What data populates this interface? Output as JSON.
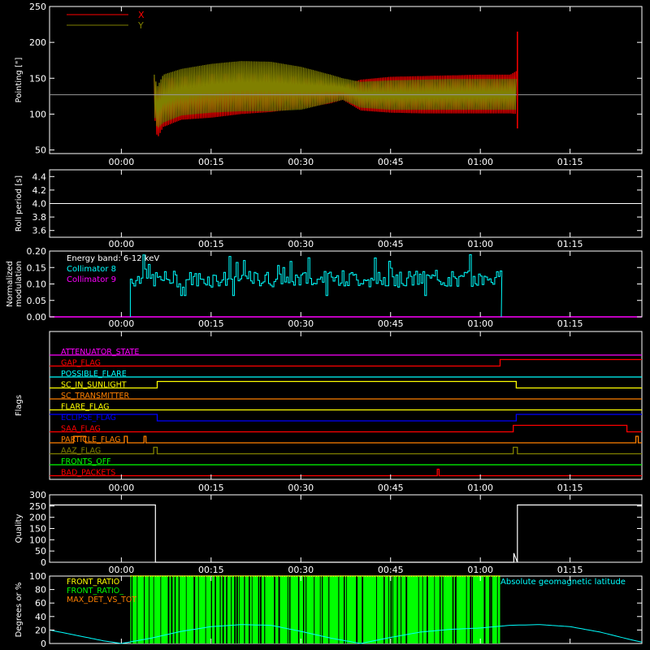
{
  "chart_data": [
    {
      "panel": "pointing",
      "type": "line",
      "ylabel": "Pointing [\"]",
      "ylim": [
        45,
        250
      ],
      "yticks": [
        50,
        100,
        150,
        200,
        250
      ],
      "xlim_minutes": [
        -12,
        87
      ],
      "xticks": [
        "00:00",
        "00:15",
        "00:30",
        "00:45",
        "01:00",
        "01:15"
      ],
      "xtick_minutes": [
        0,
        15,
        30,
        45,
        60,
        75
      ],
      "legend": [
        {
          "name": "X",
          "color": "#ff0000"
        },
        {
          "name": "Y",
          "color": "#808000"
        }
      ],
      "reference_line": 127,
      "series": [
        {
          "name": "X",
          "color": "#ff0000",
          "x": [
            5.5,
            6,
            7,
            10,
            15,
            20,
            25,
            30,
            35,
            37,
            40,
            45,
            50,
            55,
            60,
            65,
            66
          ],
          "upper": [
            150,
            132,
            150,
            152,
            156,
            157,
            156,
            152,
            145,
            140,
            148,
            152,
            153,
            154,
            155,
            155,
            160
          ],
          "lower": [
            100,
            66,
            82,
            92,
            95,
            100,
            103,
            108,
            115,
            120,
            105,
            102,
            101,
            101,
            101,
            101,
            100
          ]
        },
        {
          "name": "Y",
          "color": "#808000",
          "x": [
            5.5,
            6,
            7,
            10,
            15,
            20,
            25,
            30,
            35,
            37,
            40,
            45,
            50,
            55,
            60,
            65,
            66
          ],
          "upper": [
            155,
            138,
            155,
            163,
            170,
            174,
            173,
            166,
            155,
            150,
            145,
            147,
            148,
            149,
            149,
            149,
            149
          ],
          "lower": [
            100,
            80,
            88,
            98,
            102,
            104,
            104,
            106,
            116,
            120,
            109,
            106,
            106,
            106,
            106,
            106,
            106
          ]
        }
      ],
      "spike": {
        "x": 66.2,
        "top": 215,
        "bottom": 80
      }
    },
    {
      "panel": "roll",
      "type": "line",
      "ylabel": "Roll period [s]",
      "ylim": [
        3.5,
        4.5
      ],
      "yticks": [
        3.6,
        3.8,
        4.0,
        4.2,
        4.4
      ],
      "ytick_labels": [
        "3.6",
        "3.8",
        "4.0",
        "4.2",
        "4.4"
      ],
      "xticks": [
        "00:00",
        "00:15",
        "00:30",
        "00:45",
        "01:00",
        "01:15"
      ],
      "series": [
        {
          "name": "",
          "color": "#ffffff",
          "x": [
            -12,
            87
          ],
          "y": [
            4.0,
            4.0
          ]
        }
      ]
    },
    {
      "panel": "modulation",
      "type": "line",
      "ylabel": "Normalized modulation",
      "ylim": [
        0,
        0.2
      ],
      "yticks": [
        0.0,
        0.05,
        0.1,
        0.15,
        0.2
      ],
      "ytick_labels": [
        "0.00",
        "0.05",
        "0.10",
        "0.15",
        "0.20"
      ],
      "xticks": [
        "00:00",
        "00:15",
        "00:30",
        "00:45",
        "01:00",
        "01:15"
      ],
      "annotation": "Energy band: 6-12 keV",
      "legend": [
        {
          "name": "Collimator 8",
          "color": "#00ffff"
        },
        {
          "name": "Collimator 9",
          "color": "#ff00ff"
        }
      ],
      "series": [
        {
          "name": "Collimator 8",
          "color": "#00ffff",
          "x_start": 1.5,
          "x_end": 63.5,
          "mean": 0.115,
          "spread": 0.025
        },
        {
          "name": "Collimator 9",
          "color": "#ff00ff",
          "x": [
            -12,
            87
          ],
          "y": [
            0.0,
            0.0
          ]
        }
      ]
    },
    {
      "panel": "flags",
      "type": "line",
      "ylabel": "Flags",
      "xticks": [
        "00:00",
        "00:15",
        "00:30",
        "00:45",
        "01:00",
        "01:15"
      ],
      "series": [
        {
          "name": "ATTENUATOR_STATE",
          "color": "#ff00ff",
          "x": [
            -12,
            87
          ],
          "y": [
            0,
            0
          ]
        },
        {
          "name": "GAP_FLAG",
          "color": "#ff0000",
          "x": [
            -12,
            63.3,
            63.3,
            87
          ],
          "y": [
            0,
            0,
            1,
            1
          ]
        },
        {
          "name": "POSSIBLE_FLARE",
          "color": "#00ffff",
          "x": [
            -12,
            87
          ],
          "y": [
            0,
            0
          ]
        },
        {
          "name": "SC_IN_SUNLIGHT",
          "color": "#ffff00",
          "x": [
            -12,
            6,
            6,
            66,
            66,
            87
          ],
          "y": [
            0,
            0,
            1,
            1,
            0,
            0
          ]
        },
        {
          "name": "SC_TRANSMITTER",
          "color": "#ff8000",
          "x": [
            -12,
            87
          ],
          "y": [
            0,
            0
          ]
        },
        {
          "name": "FLARE_FLAG",
          "color": "#ffff00",
          "x": [
            -12,
            87
          ],
          "y": [
            0,
            0
          ]
        },
        {
          "name": "ECLIPSE_FLAG",
          "color": "#0000ff",
          "x": [
            -12,
            6,
            6,
            66,
            66,
            87
          ],
          "y": [
            1,
            1,
            0,
            0,
            1,
            1
          ]
        },
        {
          "name": "SAA_FLAG",
          "color": "#ff0000",
          "x": [
            -12,
            65.5,
            65.5,
            84.5,
            84.5,
            87
          ],
          "y": [
            0,
            0,
            1,
            1,
            0,
            0
          ]
        },
        {
          "name": "PARTICLE_FLAG",
          "color": "#ff8000",
          "x": [
            -12,
            -8,
            -8,
            -6,
            -6,
            0.5,
            0.5,
            1,
            1,
            3.8,
            3.8,
            4.1,
            4.1,
            86,
            86,
            86.4,
            86.4,
            87
          ],
          "y": [
            0,
            0,
            1,
            1,
            0,
            0,
            1,
            1,
            0,
            0,
            1,
            1,
            0,
            0,
            1,
            1,
            0,
            0
          ]
        },
        {
          "name": "AAZ_FLAG",
          "color": "#808000",
          "x": [
            -12,
            5.4,
            5.4,
            6,
            6,
            65.5,
            65.5,
            66.2,
            66.2,
            87
          ],
          "y": [
            0,
            0,
            1,
            1,
            0,
            0,
            1,
            1,
            0,
            0
          ]
        },
        {
          "name": "FRONTS_OFF",
          "color": "#00ff00",
          "x": [
            -12,
            87
          ],
          "y": [
            0,
            0
          ]
        },
        {
          "name": "BAD_PACKETS",
          "color": "#ff0000",
          "x": [
            -12,
            52.8,
            52.8,
            53.1,
            53.1,
            87
          ],
          "y": [
            0,
            0,
            1,
            1,
            0,
            0
          ]
        }
      ]
    },
    {
      "panel": "quality",
      "type": "line",
      "ylabel": "Quality",
      "ylim": [
        0,
        300
      ],
      "yticks": [
        0,
        50,
        100,
        150,
        200,
        250,
        300
      ],
      "xticks": [
        "00:00",
        "00:15",
        "00:30",
        "00:45",
        "01:00",
        "01:15"
      ],
      "series": [
        {
          "name": "",
          "color": "#ffffff",
          "x": [
            -12,
            5.7,
            5.7,
            65.6,
            65.6,
            66.2,
            66.2,
            87
          ],
          "y": [
            255,
            255,
            0,
            0,
            40,
            0,
            255,
            255
          ]
        }
      ]
    },
    {
      "panel": "latitude",
      "type": "area",
      "ylabel": "Degrees or %",
      "ylim": [
        0,
        100
      ],
      "yticks": [
        0,
        20,
        40,
        60,
        80,
        100
      ],
      "xticks": [
        "00:00",
        "00:15",
        "00:30",
        "00:45",
        "01:00",
        "01:15"
      ],
      "legend": [
        {
          "name": "FRONT_RATIO",
          "color": "#ffff00"
        },
        {
          "name": "FRONT_RATIO_",
          "color": "#00ff00"
        },
        {
          "name": "MAX_DET_VS_TOT",
          "color": "#ff8000"
        }
      ],
      "label_right": "Absolute geomagnetic latitude",
      "label_right_color": "#00ffff",
      "bars": {
        "x_start": 1.5,
        "x_end": 63.3,
        "value": 100
      },
      "series": [
        {
          "name": "Absolute geomagnetic latitude",
          "color": "#00ffff",
          "x": [
            -12,
            -8,
            -3,
            0,
            5,
            10,
            15,
            20,
            25,
            30,
            35,
            40,
            45,
            50,
            55,
            60,
            65,
            70,
            75,
            80,
            85,
            87
          ],
          "y": [
            20,
            13,
            4,
            0,
            8,
            18,
            25,
            28,
            27,
            18,
            8,
            0,
            9,
            17,
            21,
            23,
            27,
            28,
            25,
            17,
            6,
            2
          ]
        }
      ]
    }
  ]
}
